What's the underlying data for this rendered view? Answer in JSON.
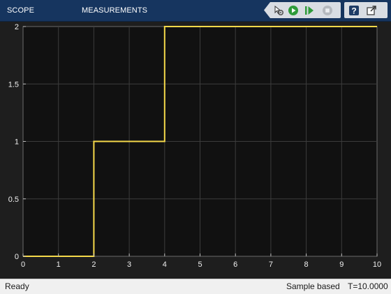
{
  "toolstrip": {
    "tabs": [
      {
        "label": "SCOPE"
      },
      {
        "label": "MEASUREMENTS"
      }
    ],
    "buttons": [
      {
        "icon": "settings-gear-icon"
      },
      {
        "icon": "run-icon",
        "color": "#2e9b3a"
      },
      {
        "icon": "step-forward-icon",
        "color": "#2e9b3a"
      },
      {
        "icon": "stop-icon"
      },
      {
        "icon": "help-icon"
      },
      {
        "icon": "undock-icon"
      }
    ]
  },
  "colors": {
    "toolstrip_bg": "#16355f",
    "plot_bg": "#111111",
    "grid": "#3c3c3c",
    "axis_text": "#f0f0f0",
    "signal": "#f5d94a"
  },
  "chart_data": {
    "type": "line",
    "title": "",
    "xlabel": "",
    "ylabel": "",
    "xlim": [
      0,
      10
    ],
    "ylim": [
      0,
      2
    ],
    "grid": true,
    "xticks": [
      "0",
      "1",
      "2",
      "3",
      "4",
      "5",
      "6",
      "7",
      "8",
      "9",
      "10"
    ],
    "yticks": [
      "0",
      "0.5",
      "1",
      "1.5",
      "2"
    ],
    "series": [
      {
        "x": [
          0,
          2,
          2,
          4,
          4,
          10
        ],
        "y": [
          0,
          0,
          1,
          1,
          2,
          2
        ]
      }
    ]
  },
  "statusbar": {
    "status": "Ready",
    "mode": "Sample based",
    "time": "T=10.0000"
  }
}
